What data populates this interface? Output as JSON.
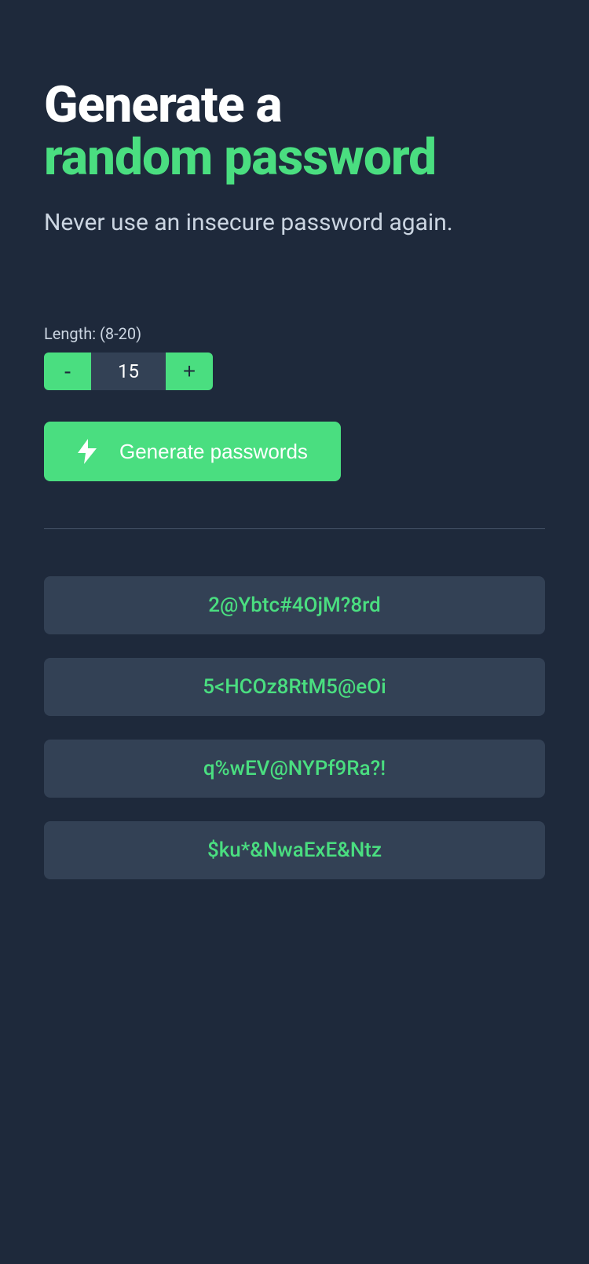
{
  "title": {
    "line1": "Generate a",
    "line2": "random password"
  },
  "subtitle": "Never use an insecure password again.",
  "length": {
    "label": "Length: (8-20)",
    "value": "15",
    "decrement": "-",
    "increment": "+"
  },
  "generate": {
    "label": "Generate passwords"
  },
  "passwords": [
    "2@Ybtc#4OjM?8rd",
    "5<HCOz8RtM5@eOi",
    "q%wEV@NYPf9Ra?!",
    "$ku*&NwaExE&Ntz"
  ]
}
